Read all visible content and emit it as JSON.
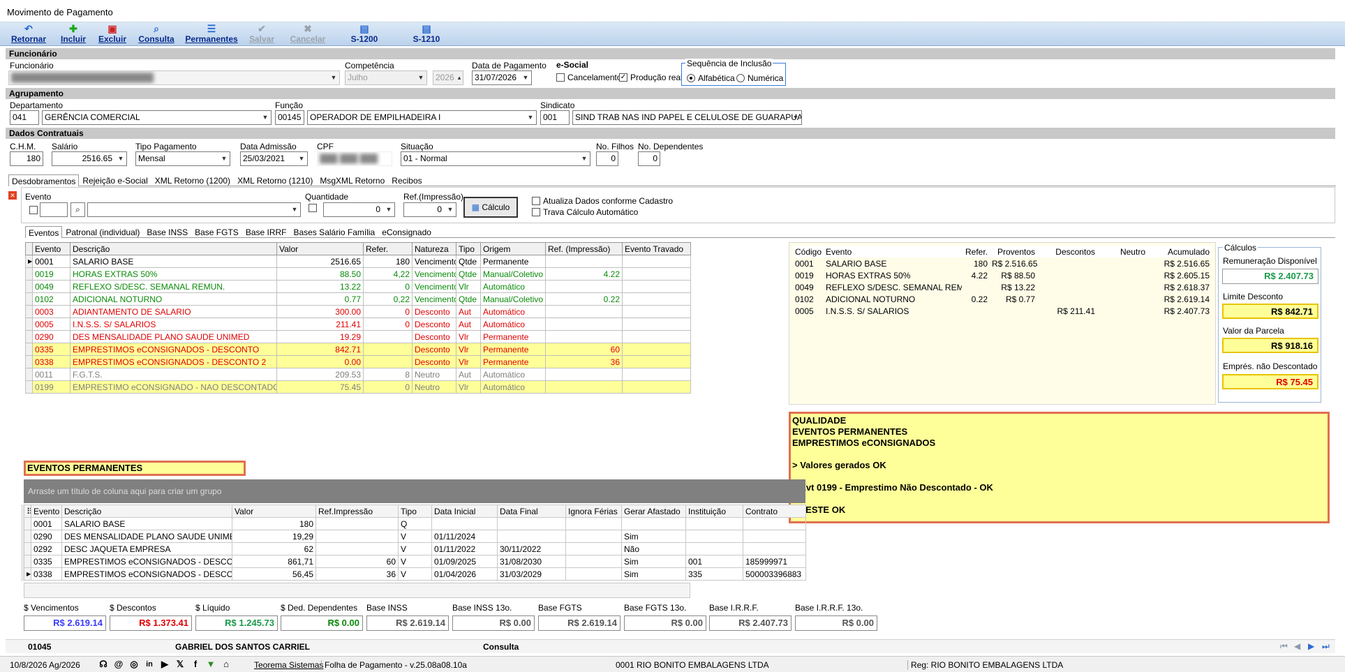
{
  "window": {
    "title": "Movimento de Pagamento"
  },
  "toolbar": {
    "retornar": "Retornar",
    "incluir": "Incluir",
    "excluir": "Excluir",
    "consulta": "Consulta",
    "permanentes": "Permanentes",
    "salvar": "Salvar",
    "cancelar": "Cancelar",
    "s1200": "S-1200",
    "s1210": "S-1210"
  },
  "funcionario": {
    "section": "Funcionário",
    "label": "Funcionário",
    "value": "",
    "competencia_label": "Competência",
    "competencia_mes": "Julho",
    "competencia_ano": "2026",
    "data_pagamento_label": "Data de Pagamento",
    "data_pagamento": "31/07/2026",
    "esocial_label": "e-Social",
    "cancelamento": "Cancelamento",
    "producao_real": "Produção real",
    "sequencia_label": "Sequência de Inclusão",
    "alfabetica": "Alfabética",
    "numerica": "Numérica"
  },
  "agrupamento": {
    "section": "Agrupamento",
    "departamento_label": "Departamento",
    "departamento_cod": "041",
    "departamento": "GERÊNCIA COMERCIAL",
    "funcao_label": "Função",
    "funcao_cod": "00145",
    "funcao": "OPERADOR DE EMPILHADEIRA I",
    "sindicato_label": "Sindicato",
    "sindicato_cod": "001",
    "sindicato": "SIND TRAB NAS IND PAPEL E CELULOSE DE GUARAPUAVA"
  },
  "contratuais": {
    "section": "Dados Contratuais",
    "chm_label": "C.H.M.",
    "chm": "180",
    "salario_label": "Salário",
    "salario": "2516.65",
    "tipo_label": "Tipo Pagamento",
    "tipo": "Mensal",
    "admissao_label": "Data Admissão",
    "admissao": "25/03/2021",
    "cpf_label": "CPF",
    "cpf": "",
    "situacao_label": "Situação",
    "situacao": "01 - Normal",
    "filhos_label": "No. Filhos",
    "filhos": "0",
    "dependentes_label": "No. Dependentes",
    "dependentes": "0"
  },
  "main_tabs": [
    "Desdobramentos",
    "Rejeição e-Social",
    "XML Retorno (1200)",
    "XML Retorno (1210)",
    "MsgXML Retorno",
    "Recibos"
  ],
  "evento_form": {
    "evento_label": "Evento",
    "quantidade_label": "Quantidade",
    "quantidade": "0",
    "ref_label": "Ref.(Impressão)",
    "ref": "0",
    "calculo": "Cálculo",
    "atualiza": "Atualiza Dados conforme Cadastro",
    "trava": "Trava Cálculo Automático"
  },
  "sub_tabs": [
    "Eventos",
    "Patronal (individual)",
    "Base INSS",
    "Base FGTS",
    "Base IRRF",
    "Bases Salário Família",
    "eConsignado"
  ],
  "eventos": {
    "headers": [
      "Evento",
      "Descrição",
      "Valor",
      "Refer.",
      "Natureza",
      "Tipo",
      "Origem",
      "Ref. (Impressão)",
      "Evento Travado"
    ],
    "rows": [
      {
        "style": "black",
        "cells": [
          "0001",
          "SALARIO BASE",
          "2516.65",
          "180",
          "Vencimento",
          "Qtde",
          "Permanente",
          "",
          ""
        ]
      },
      {
        "style": "green",
        "cells": [
          "0019",
          "HORAS EXTRAS 50%",
          "88.50",
          "4,22",
          "Vencimento",
          "Qtde",
          "Manual/Coletivo",
          "4.22",
          ""
        ]
      },
      {
        "style": "green",
        "cells": [
          "0049",
          "REFLEXO S/DESC. SEMANAL REMUN.",
          "13.22",
          "0",
          "Vencimento",
          "Vlr",
          "Automático",
          "",
          ""
        ]
      },
      {
        "style": "green",
        "cells": [
          "0102",
          "ADICIONAL NOTURNO",
          "0.77",
          "0,22",
          "Vencimento",
          "Qtde",
          "Manual/Coletivo",
          "0.22",
          ""
        ]
      },
      {
        "style": "red",
        "cells": [
          "0003",
          "ADIANTAMENTO DE SALARIO",
          "300.00",
          "0",
          "Desconto",
          "Aut",
          "Automático",
          "",
          ""
        ]
      },
      {
        "style": "red",
        "cells": [
          "0005",
          "I.N.S.S. S/ SALARIOS",
          "211.41",
          "0",
          "Desconto",
          "Aut",
          "Automático",
          "",
          ""
        ]
      },
      {
        "style": "red",
        "cells": [
          "0290",
          "DES MENSALIDADE PLANO SAUDE UNIMED",
          "19.29",
          "",
          "Desconto",
          "Vlr",
          "Permanente",
          "",
          ""
        ]
      },
      {
        "style": "red-yellow",
        "cells": [
          "0335",
          "EMPRESTIMOS eCONSIGNADOS - DESCONTO",
          "842.71",
          "",
          "Desconto",
          "Vlr",
          "Permanente",
          "60",
          ""
        ]
      },
      {
        "style": "red-yellow",
        "cells": [
          "0338",
          "EMPRESTIMOS eCONSIGNADOS - DESCONTO 2",
          "0.00",
          "",
          "Desconto",
          "Vlr",
          "Permanente",
          "36",
          ""
        ]
      },
      {
        "style": "gray",
        "cells": [
          "0011",
          "F.G.T.S.",
          "209.53",
          "8",
          "Neutro",
          "Aut",
          "Automático",
          "",
          ""
        ]
      },
      {
        "style": "gray-yellow",
        "cells": [
          "0199",
          "EMPRESTIMO eCONSIGNADO - NAO DESCONTADO",
          "75.45",
          "0",
          "Neutro",
          "Vlr",
          "Automático",
          "",
          ""
        ]
      }
    ]
  },
  "resumo": {
    "headers": [
      "Código",
      "Evento",
      "Refer.",
      "Proventos",
      "Descontos",
      "Neutro",
      "Acumulado"
    ],
    "rows": [
      [
        "0001",
        "SALARIO BASE",
        "180",
        "R$ 2.516.65",
        "",
        "",
        "R$ 2.516.65"
      ],
      [
        "0019",
        "HORAS EXTRAS 50%",
        "4.22",
        "R$ 88.50",
        "",
        "",
        "R$ 2.605.15"
      ],
      [
        "0049",
        "REFLEXO S/DESC. SEMANAL REM...",
        "",
        "R$ 13.22",
        "",
        "",
        "R$ 2.618.37"
      ],
      [
        "0102",
        "ADICIONAL NOTURNO",
        "0.22",
        "R$ 0.77",
        "",
        "",
        "R$ 2.619.14"
      ],
      [
        "0005",
        "I.N.S.S. S/ SALARIOS",
        "",
        "",
        "R$ 211.41",
        "",
        "R$ 2.407.73"
      ]
    ]
  },
  "calculos": {
    "title": "Cálculos",
    "remuneracao_label": "Remuneração Disponível",
    "remuneracao": "R$ 2.407.73",
    "limite_label": "Limite Desconto",
    "limite": "R$ 842.71",
    "parcela_label": "Valor da Parcela",
    "parcela": "R$ 918.16",
    "nao_desc_label": "Emprés. não Descontado",
    "nao_desc": "R$ 75.45"
  },
  "nota": [
    "QUALIDADE",
    "EVENTOS PERMANENTES",
    "EMPRESTIMOS eCONSIGNADOS",
    "",
    "> Valores gerados OK",
    "",
    "> Evt 0199 - Emprestimo Não Descontado - OK",
    "",
    "> TESTE OK"
  ],
  "eventos_permanentes": {
    "label": "EVENTOS PERMANENTES",
    "group_hint": "Arraste um título de coluna aqui para criar um grupo",
    "headers": [
      "Evento",
      "Descrição",
      "Valor",
      "Ref.Impressão",
      "Tipo",
      "Data Inicial",
      "Data Final",
      "Ignora Férias",
      "Gerar Afastado",
      "Instituição",
      "Contrato"
    ],
    "rows": [
      [
        "0001",
        "SALARIO BASE",
        "180",
        "",
        "Q",
        "",
        "",
        "",
        "",
        "",
        ""
      ],
      [
        "0290",
        "DES MENSALIDADE PLANO SAUDE UNIMED",
        "19,29",
        "",
        "V",
        "01/11/2024",
        "",
        "",
        "Sim",
        "",
        ""
      ],
      [
        "0292",
        "DESC JAQUETA EMPRESA",
        "62",
        "",
        "V",
        "01/11/2022",
        "30/11/2022",
        "",
        "Não",
        "",
        ""
      ],
      [
        "0335",
        "EMPRESTIMOS eCONSIGNADOS - DESCONTO",
        "861,71",
        "60",
        "V",
        "01/09/2025",
        "31/08/2030",
        "",
        "Sim",
        "001",
        "185999971"
      ],
      [
        "0338",
        "EMPRESTIMOS eCONSIGNADOS - DESCONTO",
        "56,45",
        "36",
        "V",
        "01/04/2026",
        "31/03/2029",
        "",
        "Sim",
        "335",
        "500003396883"
      ]
    ]
  },
  "totais": [
    {
      "label": "$ Vencimentos",
      "value": "R$ 2.619.14",
      "color": "#3b3bff"
    },
    {
      "label": "$ Descontos",
      "value": "R$ 1.373.41",
      "color": "#e00000"
    },
    {
      "label": "$ Líquido",
      "value": "R$ 1.245.73",
      "color": "#1a9a4a"
    },
    {
      "label": "$ Ded. Dependentes",
      "value": "R$ 0.00",
      "color": "#0a8a0a"
    },
    {
      "label": "Base INSS",
      "value": "R$ 2.619.14",
      "color": "#555555"
    },
    {
      "label": "Base INSS 13o.",
      "value": "R$ 0.00",
      "color": "#555555"
    },
    {
      "label": "Base FGTS",
      "value": "R$ 2.619.14",
      "color": "#555555"
    },
    {
      "label": "Base FGTS 13o.",
      "value": "R$ 0.00",
      "color": "#555555"
    },
    {
      "label": "Base I.R.R.F.",
      "value": "R$ 2.407.73",
      "color": "#555555"
    },
    {
      "label": "Base I.R.R.F. 13o.",
      "value": "R$ 0.00",
      "color": "#555555"
    }
  ],
  "footer": {
    "codigo": "01045",
    "nome": "GABRIEL DOS SANTOS CARRIEL",
    "modo": "Consulta"
  },
  "statusbar": {
    "data": "10/8/2026 Ag/2026",
    "empresa_link": "Teorema Sistemas",
    "versao": "Folha de Pagamento - v.25.08a08.10a",
    "empresa": "0001 RIO BONITO EMBALAGENS LTDA",
    "reg": "Reg: RIO BONITO EMBALAGENS LTDA"
  },
  "colors": {
    "accent": "#0a2a8a",
    "highlight": "#ffff99",
    "note_border": "#e07050"
  }
}
